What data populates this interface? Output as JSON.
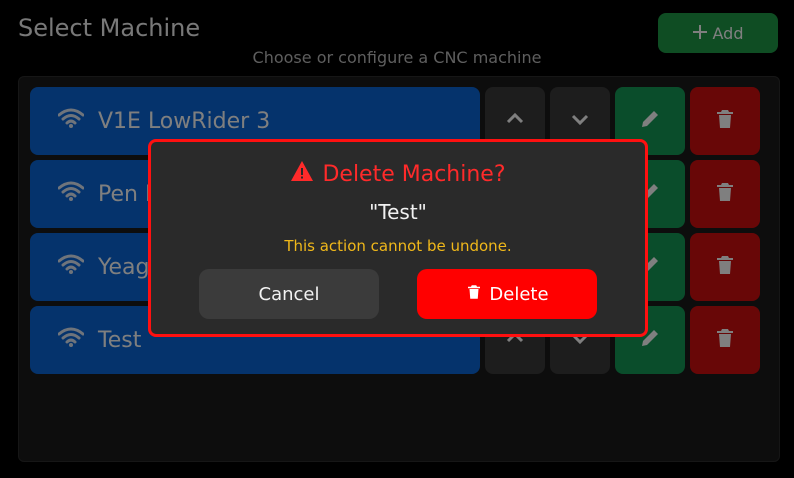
{
  "header": {
    "title": "Select Machine",
    "subtitle": "Choose or configure a CNC machine",
    "add_label": "Add"
  },
  "machines": [
    {
      "name": "V1E LowRider 3"
    },
    {
      "name": "Pen P"
    },
    {
      "name": "Yeag"
    },
    {
      "name": "Test"
    }
  ],
  "dialog": {
    "title": "Delete Machine?",
    "machine_name": "\"Test\"",
    "warning": "This action cannot be undone.",
    "cancel_label": "Cancel",
    "delete_label": "Delete"
  },
  "colors": {
    "machine_button": "#0a66d8",
    "edit_button": "#159b57",
    "delete_button": "#d10f0f",
    "dialog_border": "#ff1010",
    "warning_text": "#f0b81a"
  },
  "icons": {
    "add": "plus-icon",
    "machine": "wifi-icon",
    "move_up": "chevron-up-icon",
    "move_down": "chevron-down-icon",
    "edit": "pencil-icon",
    "delete": "trash-icon",
    "warning": "warning-triangle-icon"
  }
}
